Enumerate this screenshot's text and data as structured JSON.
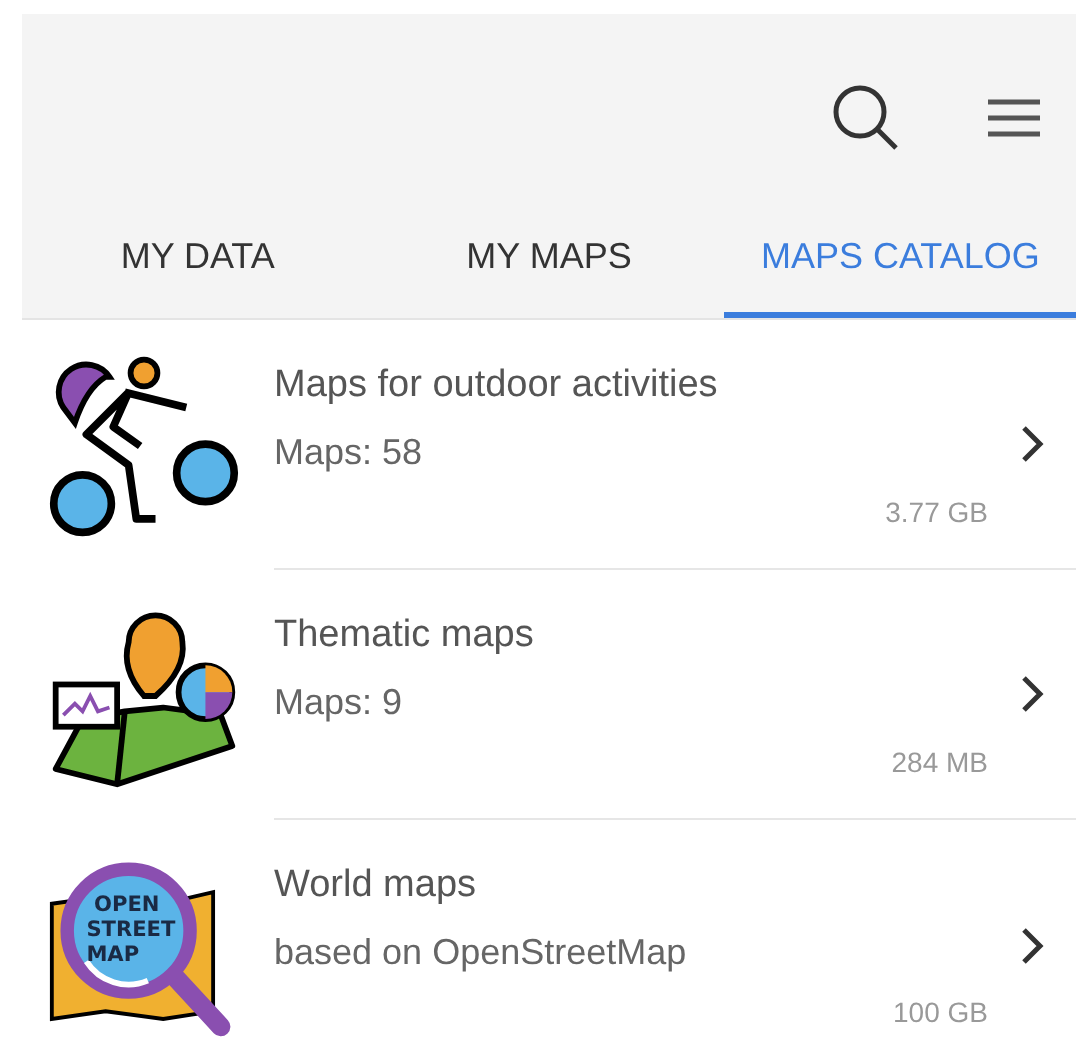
{
  "toolbar": {
    "tabs": [
      {
        "label": "MY DATA",
        "selected": false
      },
      {
        "label": "MY MAPS",
        "selected": false
      },
      {
        "label": "MAPS CATALOG",
        "selected": true
      }
    ]
  },
  "catalog": [
    {
      "kind": "cyclist",
      "title": "Maps for outdoor activities",
      "subtitle": "Maps: 58",
      "size": "3.77 GB"
    },
    {
      "kind": "thematic",
      "title": "Thematic maps",
      "subtitle": "Maps: 9",
      "size": "284 MB"
    },
    {
      "kind": "world",
      "title": "World maps",
      "subtitle": "based on OpenStreetMap",
      "size": "100 GB",
      "logo_text": [
        "OPEN",
        "STREET",
        "MAP"
      ]
    }
  ]
}
